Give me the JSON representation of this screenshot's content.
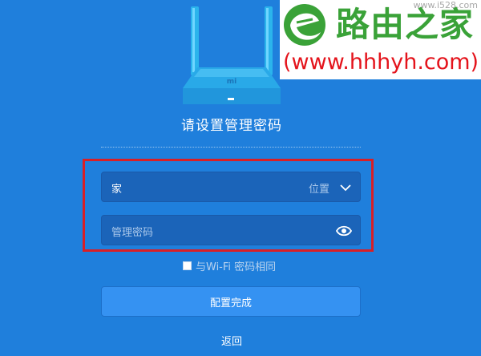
{
  "page": {
    "title": "请设置管理密码",
    "background_color": "#1f7fdc"
  },
  "router_image": {
    "icon": "router-icon",
    "logo_text": "mi"
  },
  "watermark": {
    "site_name": "路由之家",
    "url": "(www.hhhyh.com)",
    "small_text": "www.i528.com",
    "logo_icon": "leaf-e-logo-icon"
  },
  "form": {
    "wifi_name": {
      "value": "家",
      "hint": "位置",
      "icon": "chevron-down-icon"
    },
    "admin_password": {
      "placeholder": "管理密码",
      "icon": "eye-icon"
    },
    "same_as_wifi": {
      "label": "与Wi-Fi 密码相同",
      "checked": false
    },
    "highlight_color": "#d91f26"
  },
  "actions": {
    "submit_label": "配置完成",
    "back_label": "返回"
  }
}
